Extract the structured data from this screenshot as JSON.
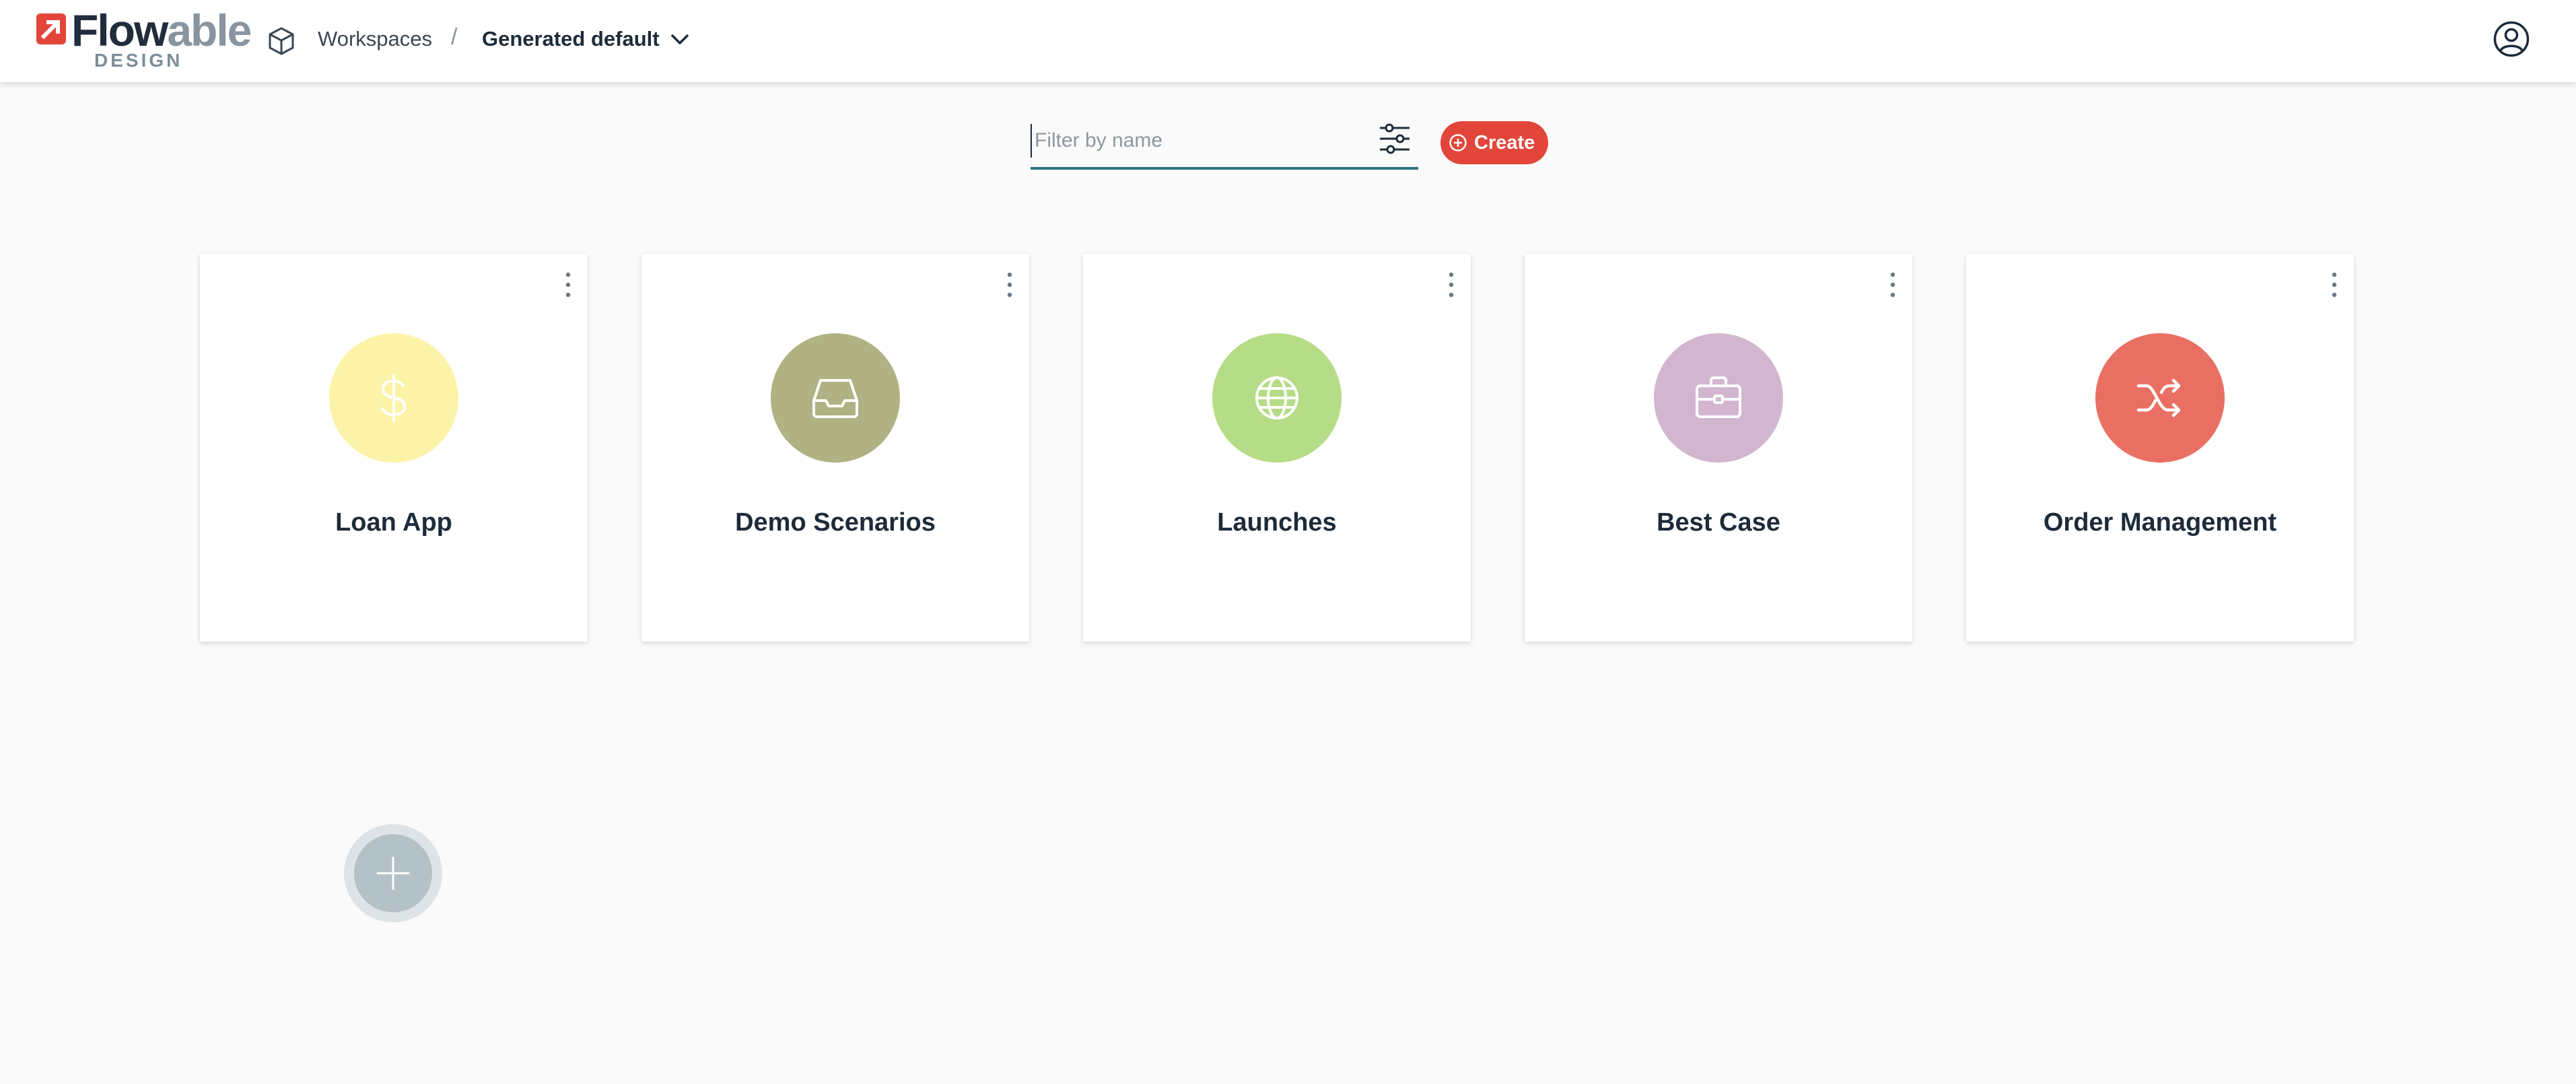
{
  "app": {
    "logo_word_flow": "Flow",
    "logo_word_able": "able",
    "logo_subtitle": "DESIGN",
    "brand_color": "#e2463b"
  },
  "breadcrumb": {
    "root_label": "Workspaces",
    "separator": "/",
    "current_label": "Generated default",
    "current_icon": "chevron-down-icon",
    "root_icon": "cube-icon"
  },
  "header": {
    "user_icon": "user-circle-icon"
  },
  "toolbar": {
    "search_placeholder": "Filter by name",
    "search_value": "",
    "filter_icon": "sliders-icon",
    "create_label": "Create",
    "create_icon": "plus-circle-icon"
  },
  "cards": [
    {
      "title": "Loan App",
      "icon": "dollar-icon",
      "color": "#fdf3a8",
      "icon_color": "#ffffff"
    },
    {
      "title": "Demo Scenarios",
      "icon": "inbox-icon",
      "color": "#b0b283",
      "icon_color": "#ffffff"
    },
    {
      "title": "Launches",
      "icon": "globe-icon",
      "color": "#b5dc86",
      "icon_color": "#ffffff"
    },
    {
      "title": "Best Case",
      "icon": "briefcase-icon",
      "color": "#d2b6cf",
      "icon_color": "#ffffff"
    },
    {
      "title": "Order Management",
      "icon": "shuffle-icon",
      "color": "#e96f63",
      "icon_color": "#ffffff"
    }
  ],
  "fab": {
    "icon": "plus-icon"
  }
}
